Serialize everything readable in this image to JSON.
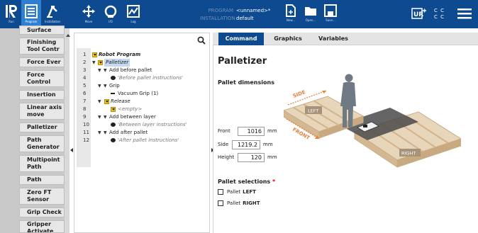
{
  "topbar": {
    "run_label": "Run",
    "program_label": "Program",
    "installation_label": "Installation",
    "move_label": "Move",
    "io_label": "I/O",
    "log_label": "Log",
    "program_key": "PROGRAM",
    "program_value": "<unnamed>*",
    "installation_key": "INSTALLATION",
    "installation_value": "default",
    "new_label": "New...",
    "open_label": "Open...",
    "save_label": "Save...",
    "speed_line1": "C C",
    "speed_line2": "C C"
  },
  "sidebar": {
    "items": [
      {
        "label": "Find Surface"
      },
      {
        "label": "Finishing Tool Contr"
      },
      {
        "label": "Force Ever"
      },
      {
        "label": "Force Control"
      },
      {
        "label": "Insertion"
      },
      {
        "label": "Linear axis move"
      },
      {
        "label": "Palletizer"
      },
      {
        "label": "Path Generator"
      },
      {
        "label": "Multipoint Path"
      },
      {
        "label": "Path"
      },
      {
        "label": "Zero FT Sensor"
      },
      {
        "label": "Grip Check"
      },
      {
        "label": "Gripper Activate"
      }
    ]
  },
  "program_tree": {
    "rows": [
      {
        "num": "1",
        "text": "Robot Program"
      },
      {
        "num": "2",
        "text": "Palletizer"
      },
      {
        "num": "3",
        "text": "Add before pallet"
      },
      {
        "num": "4",
        "text": "'Before pallet instructions'"
      },
      {
        "num": "5",
        "text": "Grip"
      },
      {
        "num": "6",
        "text": "Vacuum Grip  (1)"
      },
      {
        "num": "7",
        "text": "Release"
      },
      {
        "num": "8",
        "text": "<empty>"
      },
      {
        "num": "9",
        "text": "Add between layer"
      },
      {
        "num": "10",
        "text": "'Between layer instructions'"
      },
      {
        "num": "11",
        "text": "Add after pallet"
      },
      {
        "num": "12",
        "text": "'After pallet instructions'"
      }
    ]
  },
  "tabs": [
    {
      "label": "Command",
      "active": true
    },
    {
      "label": "Graphics",
      "active": false
    },
    {
      "label": "Variables",
      "active": false
    }
  ],
  "command": {
    "title": "Palletizer",
    "dimensions_heading": "Pallet dimensions",
    "front_label": "Front",
    "front_value": "1016",
    "front_unit": "mm",
    "side_label": "Side",
    "side_value": "1219.2",
    "side_unit": "mm",
    "height_label": "Height",
    "height_value": "120",
    "height_unit": "mm",
    "selections_heading": "Pallet selections",
    "required_mark": "*",
    "pallet_prefix": "Pallet",
    "left_label": "LEFT",
    "right_label": "RIGHT",
    "illus_side": "SIDE",
    "illus_front": "FRONT",
    "illus_left": "LEFT",
    "illus_right": "RIGHT"
  },
  "colors": {
    "topbar": "#0e4a8f",
    "active_tab": "#0e4a8f",
    "highlight": "#c5d9f1",
    "pallet_wood": "#dfc7a6",
    "arrow_orange": "#e8813a"
  }
}
